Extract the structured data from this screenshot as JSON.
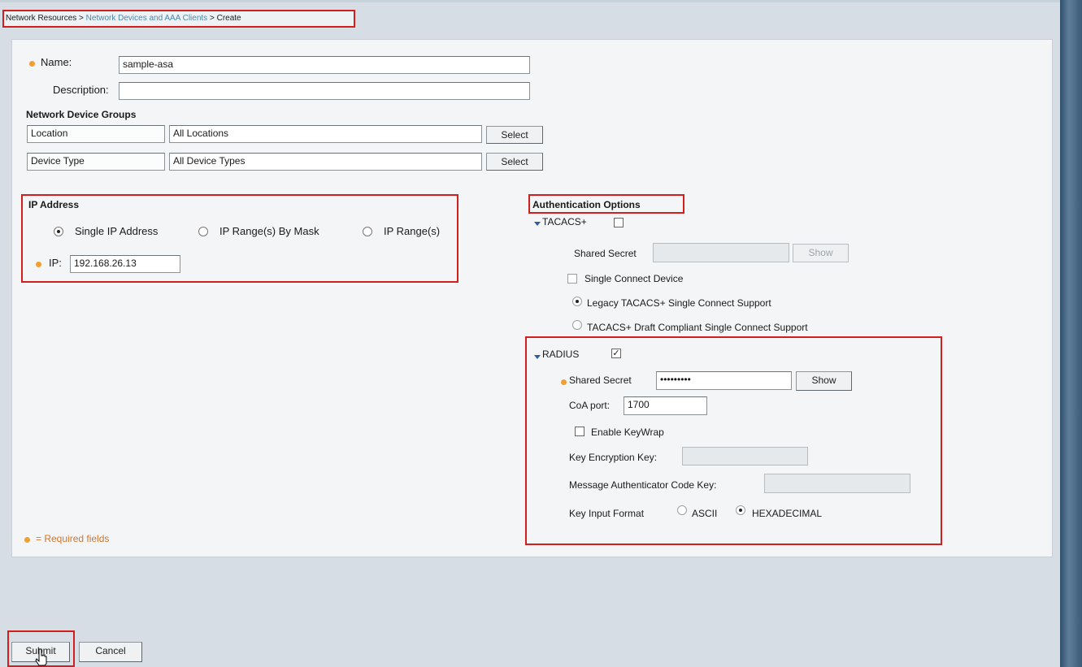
{
  "breadcrumb": {
    "part1": "Network Resources",
    "sep1": " > ",
    "part2": "Network Devices and AAA Clients",
    "sep2": " > ",
    "part3": "Create"
  },
  "form": {
    "name_label": "Name:",
    "name_value": "sample-asa",
    "description_label": "Description:",
    "description_value": ""
  },
  "ndg": {
    "heading": "Network Device Groups",
    "rows": [
      {
        "label": "Location",
        "value": "All Locations",
        "button": "Select"
      },
      {
        "label": "Device Type",
        "value": "All Device Types",
        "button": "Select"
      }
    ]
  },
  "ip": {
    "heading": "IP Address",
    "options": [
      "Single IP Address",
      "IP Range(s) By Mask",
      "IP Range(s)"
    ],
    "selected": "Single IP Address",
    "ip_label": "IP:",
    "ip_value": "192.168.26.13"
  },
  "auth": {
    "heading": "Authentication Options",
    "tacacs": {
      "label": "TACACS+",
      "enabled": false,
      "shared_secret_label": "Shared Secret",
      "show_button": "Show",
      "single_connect_label": "Single Connect Device",
      "legacy_label": "Legacy TACACS+ Single Connect Support",
      "draft_label": "TACACS+ Draft Compliant Single Connect Support"
    },
    "radius": {
      "label": "RADIUS",
      "enabled": true,
      "shared_secret_label": "Shared Secret",
      "shared_secret_value": "•••••••••",
      "show_button": "Show",
      "coa_label": "CoA port:",
      "coa_value": "1700",
      "keywrap_label": "Enable KeyWrap",
      "kek_label": "Key Encryption Key:",
      "mack_label": "Message Authenticator Code Key:",
      "format_label": "Key Input Format",
      "format_ascii": "ASCII",
      "format_hex": "HEXADECIMAL",
      "format_selected": "HEXADECIMAL"
    }
  },
  "required_note": "= Required fields",
  "footer": {
    "submit": "Submit",
    "cancel": "Cancel"
  },
  "colors": {
    "accent_red": "#d11f1f",
    "required_orange": "#f0a030",
    "link_blue": "#4c87a8"
  }
}
